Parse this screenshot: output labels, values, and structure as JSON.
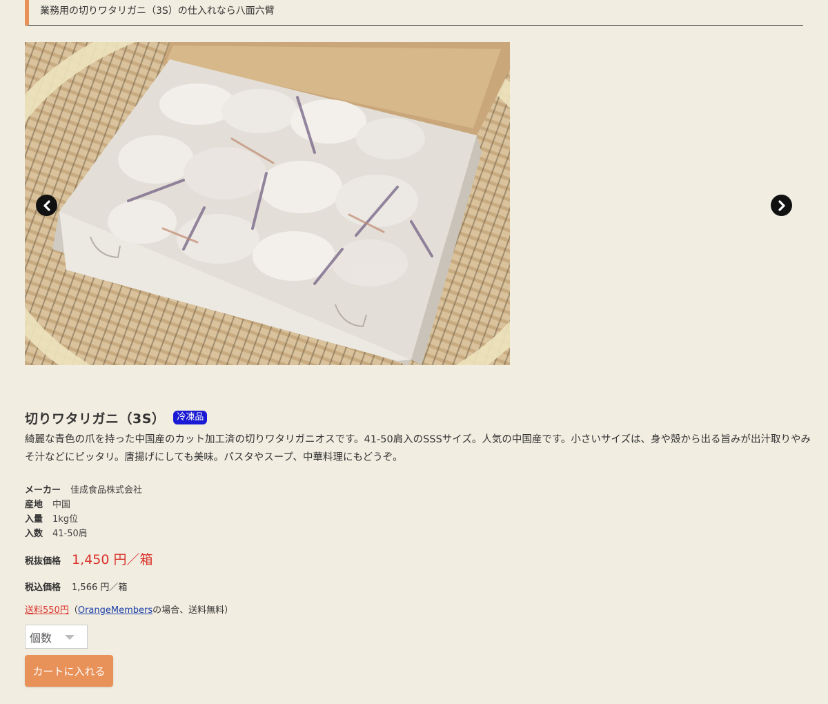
{
  "header": {
    "title": "業務用の切りワタリガニ（3S）の仕入れなら八面六臂"
  },
  "product": {
    "name": "切りワタリガニ（3S）",
    "badge": "冷凍品",
    "description": "綺麗な青色の爪を持った中国産のカット加工済の切りワタリガニオスです。41-50肩入のSSSサイズ。人気の中国産です。小さいサイズは、身や殻から出る旨みが出汁取りやみそ汁などにピッタリ。唐揚げにしても美味。パスタやスープ、中華料理にもどうぞ。",
    "specs": [
      {
        "label": "メーカー",
        "value": "佳成食品株式会社"
      },
      {
        "label": "産地",
        "value": "中国"
      },
      {
        "label": "入量",
        "value": "1kg位"
      },
      {
        "label": "入数",
        "value": "41-50肩"
      }
    ],
    "price_excl_label": "税抜価格",
    "price_excl_value": "1,450 円／箱",
    "price_incl_label": "税込価格",
    "price_incl_value": "1,566 円／箱",
    "shipping_link": "送料550円",
    "shipping_note_open": "（",
    "shipping_members_link": "OrangeMembers",
    "shipping_note_close": "の場合、送料無料）"
  },
  "gallery": {
    "prev_icon": "chevron-left-icon",
    "next_icon": "chevron-right-icon"
  },
  "controls": {
    "qty_placeholder": "個数",
    "cart_button": "カートに入れる"
  },
  "colors": {
    "background": "#f2ede1",
    "accent": "#e8925a",
    "price_red": "#d9322a",
    "badge_blue": "#1a1ad4",
    "link_blue": "#1a3fa8"
  }
}
